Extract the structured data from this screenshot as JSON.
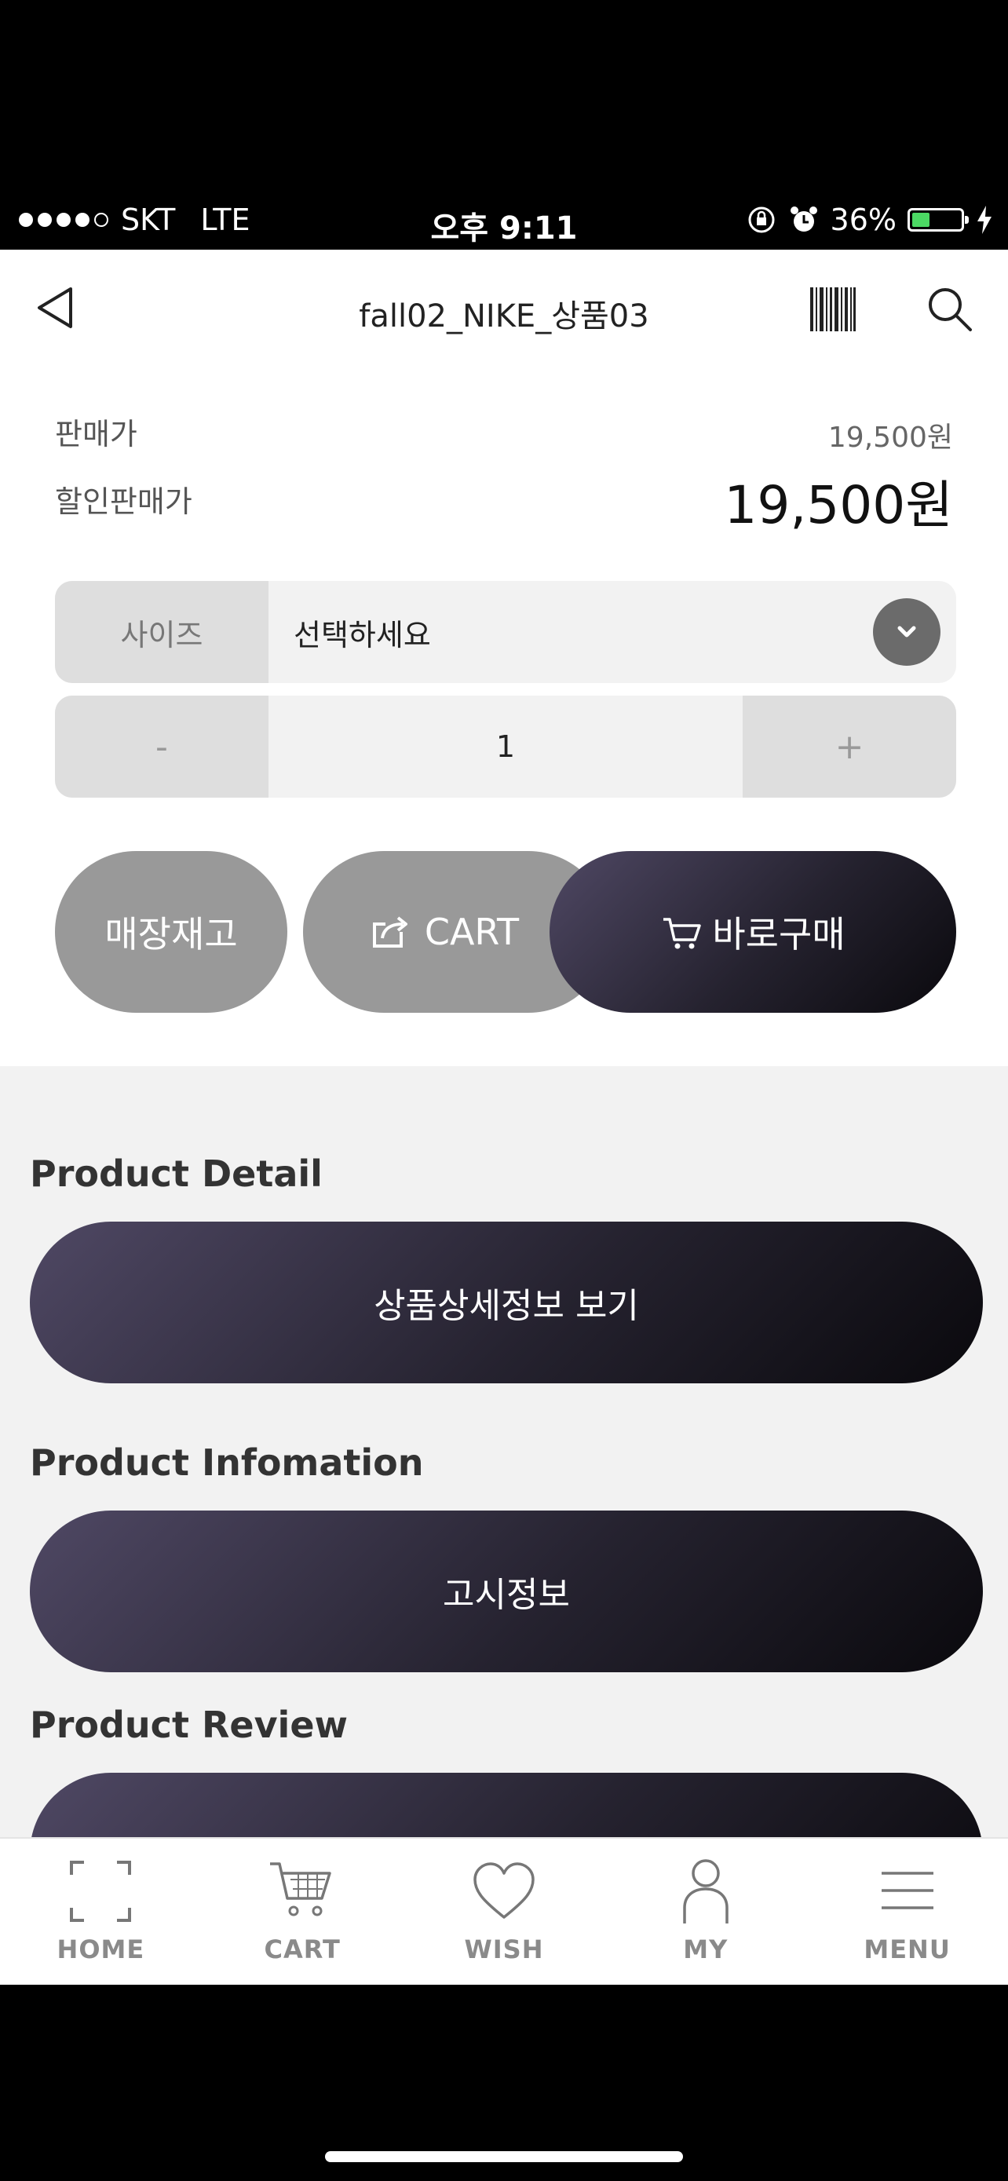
{
  "status_bar": {
    "carrier": "SKT",
    "network": "LTE",
    "time": "오후 9:11",
    "battery": "36%",
    "battery_level": 0.36
  },
  "header": {
    "title": "fall02_NIKE_상품03",
    "icons": [
      "back-icon",
      "barcode-icon",
      "search-icon"
    ]
  },
  "price": {
    "sale_label": "판매가",
    "sale_value": "19,500원",
    "discount_label": "할인판매가",
    "discount_value": "19,500원"
  },
  "options": {
    "size_label": "사이즈",
    "size_value": "선택하세요"
  },
  "quantity": {
    "minus": "-",
    "value": "1",
    "plus": "+"
  },
  "actions": {
    "store_stock": "매장재고",
    "cart": "CART",
    "buy_now": "바로구매"
  },
  "sections": [
    {
      "title": "Product Detail",
      "button": "상품상세정보 보기"
    },
    {
      "title": "Product Infomation",
      "button": "고시정보"
    },
    {
      "title": "Product Review",
      "button": ""
    }
  ],
  "tabbar": {
    "items": [
      {
        "label": "HOME",
        "icon": "home-frame-icon"
      },
      {
        "label": "CART",
        "icon": "cart-icon"
      },
      {
        "label": "WISH",
        "icon": "heart-icon"
      },
      {
        "label": "MY",
        "icon": "person-icon"
      },
      {
        "label": "MENU",
        "icon": "menu-icon"
      }
    ]
  },
  "colors": {
    "dark_button_start": "#4f4864",
    "dark_button_end": "#0a090d",
    "gray_button": "#999999",
    "battery_fill": "#4cd964"
  }
}
